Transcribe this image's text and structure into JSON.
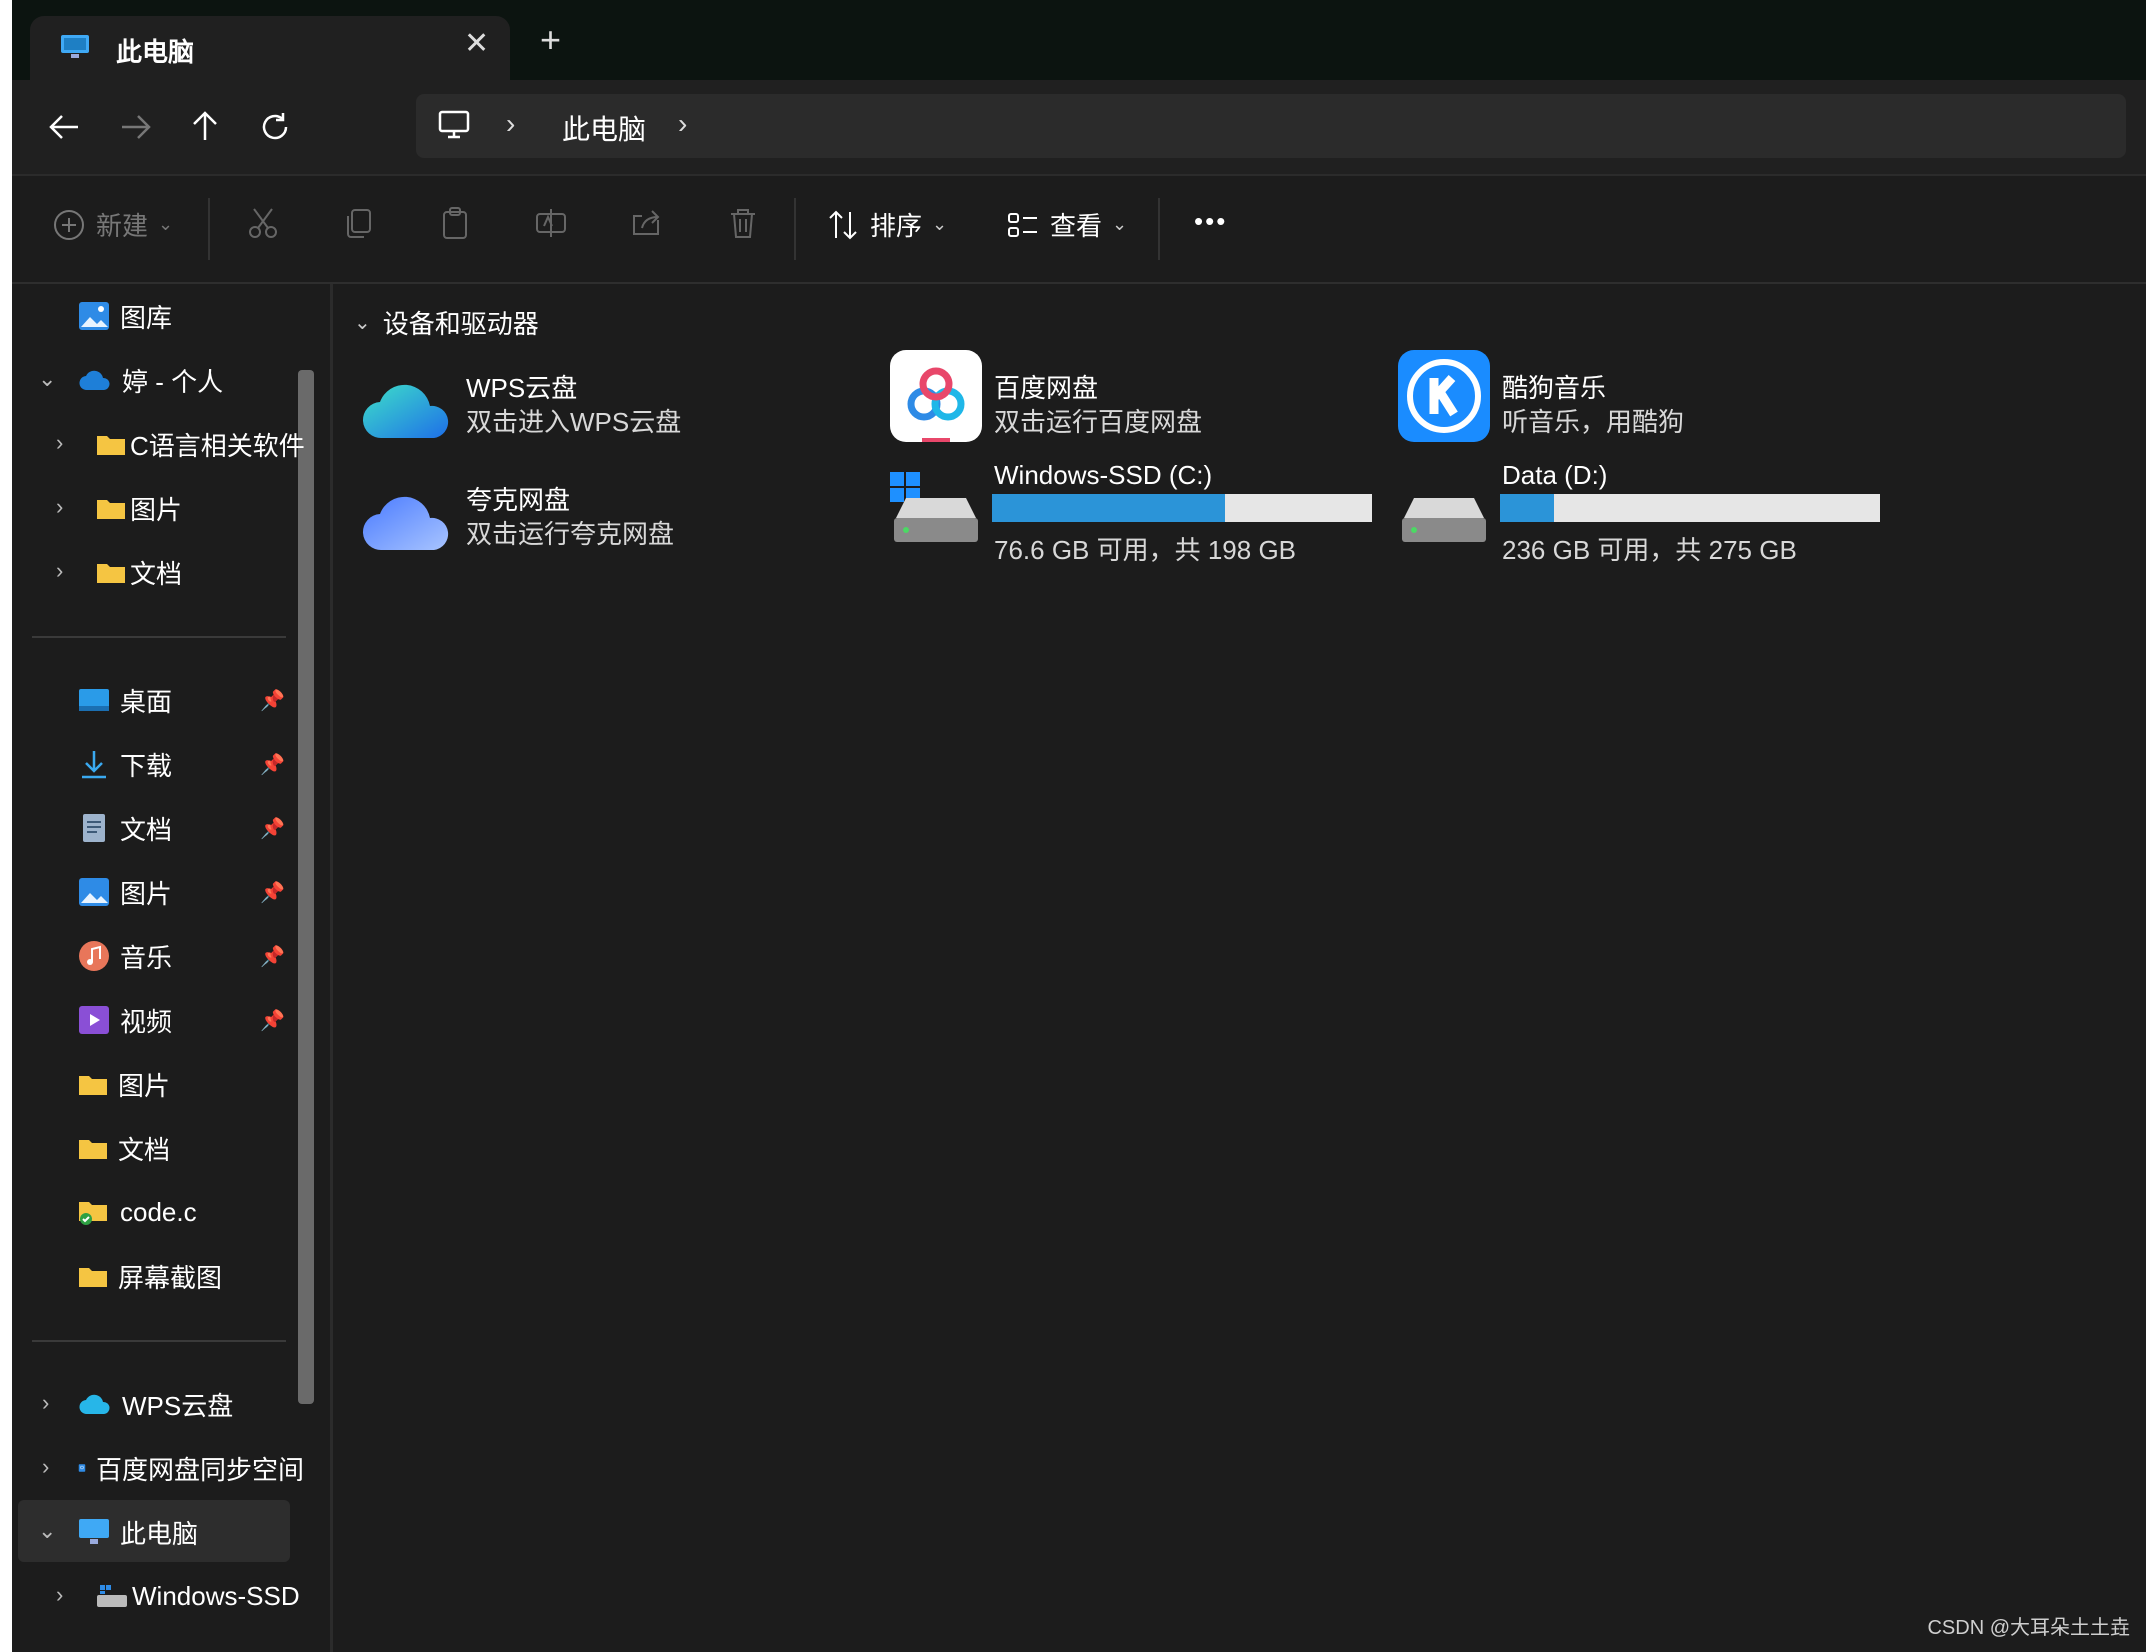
{
  "tab": {
    "title": "此电脑",
    "close": "✕",
    "new": "+"
  },
  "address": {
    "crumb": "此电脑",
    "chevron": "›"
  },
  "commands": {
    "new": "新建",
    "sort": "排序",
    "view": "查看",
    "more": "•••"
  },
  "sidebar": {
    "gallery": "图库",
    "onedrive": "婷 - 个人",
    "od_children": [
      "C语言相关软件",
      "图片",
      "文档"
    ],
    "pinned": [
      "桌面",
      "下载",
      "文档",
      "图片",
      "音乐",
      "视频"
    ],
    "folders": [
      "图片",
      "文档",
      "code.c",
      "屏幕截图"
    ],
    "wps": "WPS云盘",
    "baidu": "百度网盘同步空间",
    "thispc": "此电脑",
    "windows_ssd": "Windows-SSD"
  },
  "main": {
    "section_title": "设备和驱动器",
    "apps": [
      {
        "name": "WPS云盘",
        "desc": "双击进入WPS云盘"
      },
      {
        "name": "百度网盘",
        "desc": "双击运行百度网盘"
      },
      {
        "name": "酷狗音乐",
        "desc": "听音乐，用酷狗"
      },
      {
        "name": "夸克网盘",
        "desc": "双击运行夸克网盘"
      }
    ],
    "drives": [
      {
        "name": "Windows-SSD (C:)",
        "free": "76.6 GB 可用，共 198 GB",
        "used_fraction": 0.613
      },
      {
        "name": "Data (D:)",
        "free": "236 GB 可用，共 275 GB",
        "used_fraction": 0.142
      }
    ]
  },
  "watermark": "CSDN @大耳朵土土垚",
  "colors": {
    "accent": "#2b94d8",
    "folder": "#f5c542",
    "bg": "#1c1c1c"
  }
}
